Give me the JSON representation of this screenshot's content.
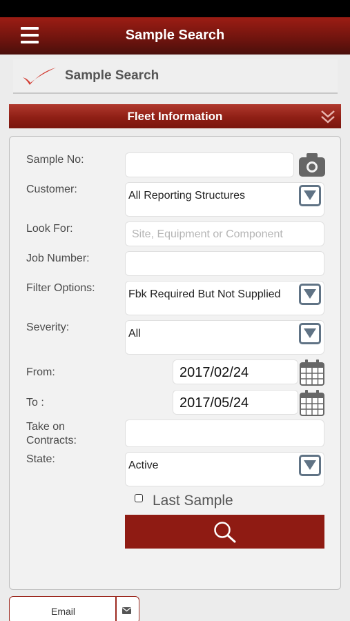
{
  "navbar": {
    "title": "Sample Search"
  },
  "subheader": {
    "title": "Sample Search"
  },
  "section": {
    "title": "Fleet Information"
  },
  "form": {
    "sample_no": {
      "label": "Sample No:",
      "value": ""
    },
    "customer": {
      "label": "Customer:",
      "value": "All Reporting Structures"
    },
    "look_for": {
      "label": "Look For:",
      "placeholder": "Site, Equipment or Component",
      "value": ""
    },
    "job_number": {
      "label": "Job Number:",
      "value": ""
    },
    "filter_options": {
      "label": "Filter Options:",
      "value": "Fbk Required But Not Supplied"
    },
    "severity": {
      "label": "Severity:",
      "value": "All"
    },
    "from": {
      "label": "From:",
      "value": "2017/02/24"
    },
    "to": {
      "label": "To :",
      "value": "2017/05/24"
    },
    "take_on": {
      "label_line1": "Take on",
      "label_line2": "Contracts:",
      "value": ""
    },
    "state": {
      "label": "State:",
      "value": "Active"
    },
    "last_sample": {
      "label": "Last Sample",
      "checked": false
    }
  },
  "footer": {
    "email_label": "Email"
  },
  "icons": {
    "menu": "hamburger-menu-icon",
    "logo": "checkmark-logo-icon",
    "collapse": "double-chevron-down-icon",
    "camera": "camera-icon",
    "dropdown": "triangle-down-icon",
    "calendar": "calendar-icon",
    "search": "magnifier-icon",
    "mail": "envelope-icon"
  },
  "colors": {
    "primary": "#8f1b13",
    "dropdown_border": "#607385"
  }
}
